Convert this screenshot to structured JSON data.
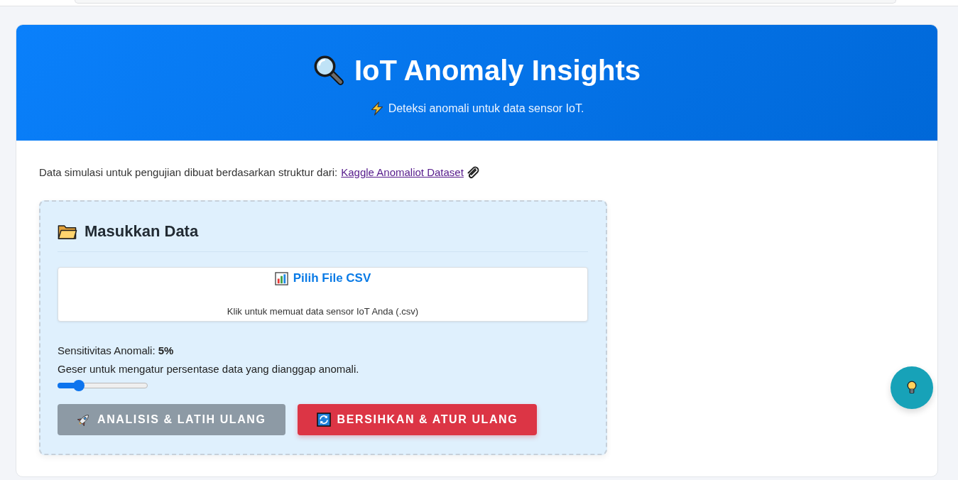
{
  "header": {
    "title": "IoT Anomaly Insights",
    "subtitle": "Deteksi anomali untuk data sensor IoT."
  },
  "intro": {
    "text": "Data simulasi untuk pengujian dibuat berdasarkan struktur dari:",
    "link": "Kaggle Anomaliot Dataset"
  },
  "input_panel": {
    "title": "Masukkan Data",
    "file_picker": {
      "label": "Pilih File CSV",
      "hint": "Klik untuk memuat data sensor IoT Anda (.csv)"
    },
    "sensitivity": {
      "label": "Sensitivitas Anomali: **5%**",
      "hint": "Geser untuk mengatur persentase data yang dianggap anomali.",
      "level": 0.2
    },
    "buttons": [
      {
        "label": "ANALISIS & LATIH ULANG",
        "kind": "analyze",
        "disabled": true
      },
      {
        "label": "BERSIHKAN & ATUR ULANG",
        "kind": "reset",
        "disabled": false
      }
    ]
  }
}
